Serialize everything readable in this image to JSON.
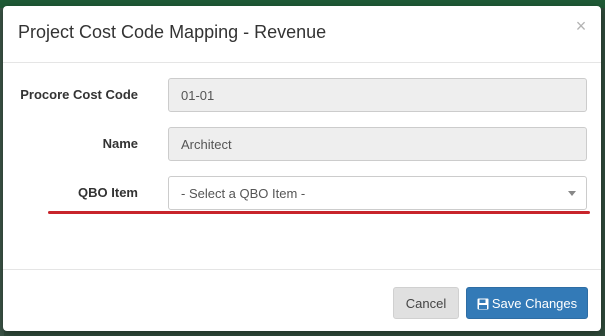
{
  "modal": {
    "title": "Project Cost Code Mapping - Revenue",
    "close_symbol": "×"
  },
  "form": {
    "procore_cost_code": {
      "label": "Procore Cost Code",
      "value": "01-01"
    },
    "name": {
      "label": "Name",
      "value": "Architect"
    },
    "qbo_item": {
      "label": "QBO Item",
      "selected": "- Select a QBO Item -"
    }
  },
  "footer": {
    "cancel_label": "Cancel",
    "save_label": "Save Changes"
  },
  "colors": {
    "primary": "#337ab7",
    "highlight_underline": "#c8242b"
  }
}
